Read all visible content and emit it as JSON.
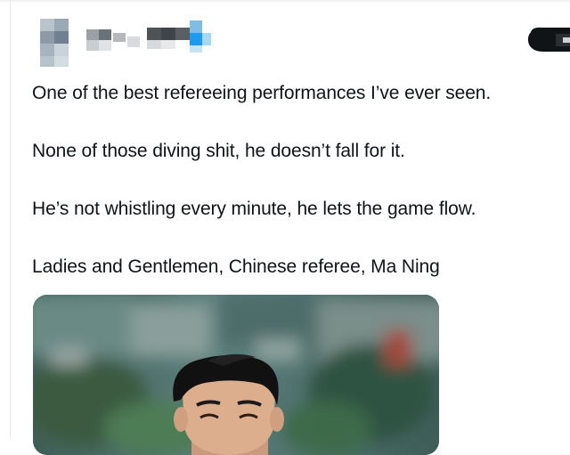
{
  "tweet": {
    "lines": [
      "One of the best refereeing performances I’ve ever seen.",
      "None of those diving shit, he doesn’t fall for it.",
      "He’s not whistling every minute, he lets the game flow.",
      "Ladies and Gentlemen, Chinese referee, Ma Ning"
    ]
  },
  "author": {
    "avatar_icon": "blurred-avatar-icon",
    "name_icon": "blurred-name-icon"
  },
  "actions": {
    "more_icon": "more-options-icon"
  },
  "media": {
    "icon": "referee-photo"
  },
  "colors": {
    "text": "#0f1419",
    "background": "#ffffff",
    "accent_blue": "#1d9bf0"
  }
}
